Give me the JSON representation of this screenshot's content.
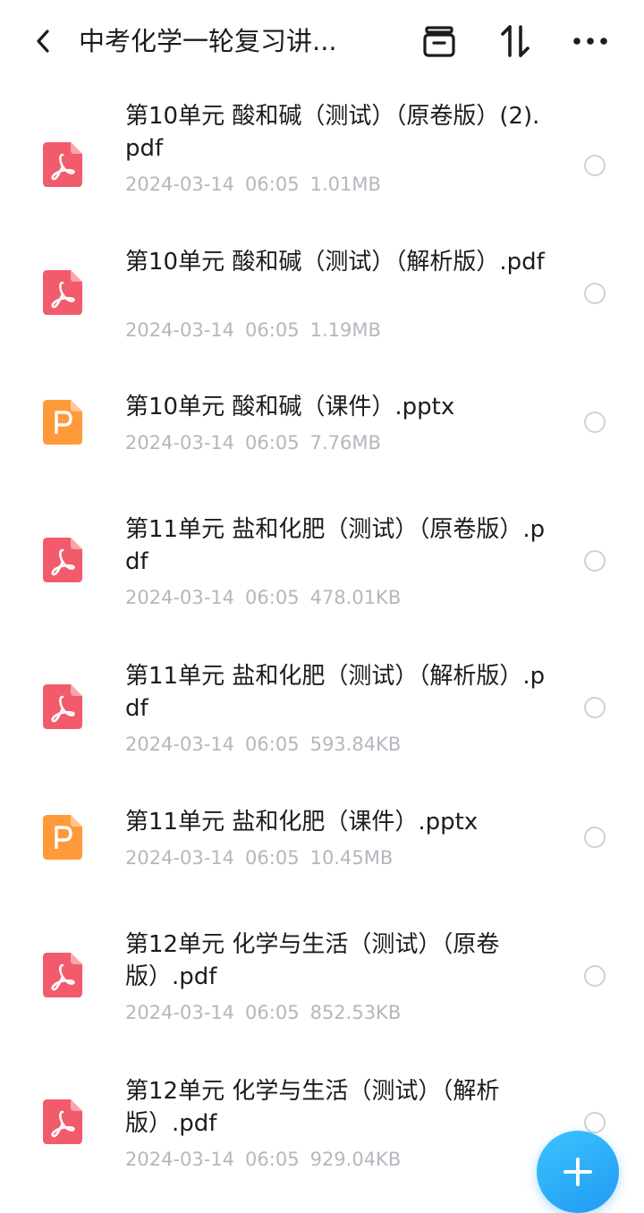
{
  "header": {
    "title": "中考化学一轮复习讲...",
    "icons": [
      "back-icon",
      "archive-icon",
      "sort-icon",
      "more-icon"
    ]
  },
  "colors": {
    "pdf": "#f25b6b",
    "pptx": "#ff9a3b",
    "fab": "#2ba9f7",
    "meta_text": "#b4b7bd"
  },
  "files": [
    {
      "type": "pdf",
      "name": "第10单元 酸和碱（测试）（原卷版）(2).pdf",
      "date": "2024-03-14",
      "time": "06:05",
      "size": "1.01MB"
    },
    {
      "type": "pdf",
      "name": "第10单元 酸和碱（测试）（解析版）.pdf",
      "date": "2024-03-14",
      "time": "06:05",
      "size": "1.19MB"
    },
    {
      "type": "pptx",
      "name": "第10单元 酸和碱（课件）.pptx",
      "date": "2024-03-14",
      "time": "06:05",
      "size": "7.76MB"
    },
    {
      "type": "pdf",
      "name": "第11单元 盐和化肥（测试）（原卷版）.pdf",
      "date": "2024-03-14",
      "time": "06:05",
      "size": "478.01KB"
    },
    {
      "type": "pdf",
      "name": "第11单元 盐和化肥（测试）（解析版）.pdf",
      "date": "2024-03-14",
      "time": "06:05",
      "size": "593.84KB"
    },
    {
      "type": "pptx",
      "name": "第11单元 盐和化肥（课件）.pptx",
      "date": "2024-03-14",
      "time": "06:05",
      "size": "10.45MB"
    },
    {
      "type": "pdf",
      "name": "第12单元 化学与生活（测试）（原卷版）.pdf",
      "date": "2024-03-14",
      "time": "06:05",
      "size": "852.53KB"
    },
    {
      "type": "pdf",
      "name": "第12单元 化学与生活（测试）（解析版）.pdf",
      "date": "2024-03-14",
      "time": "06:05",
      "size": "929.04KB"
    }
  ]
}
